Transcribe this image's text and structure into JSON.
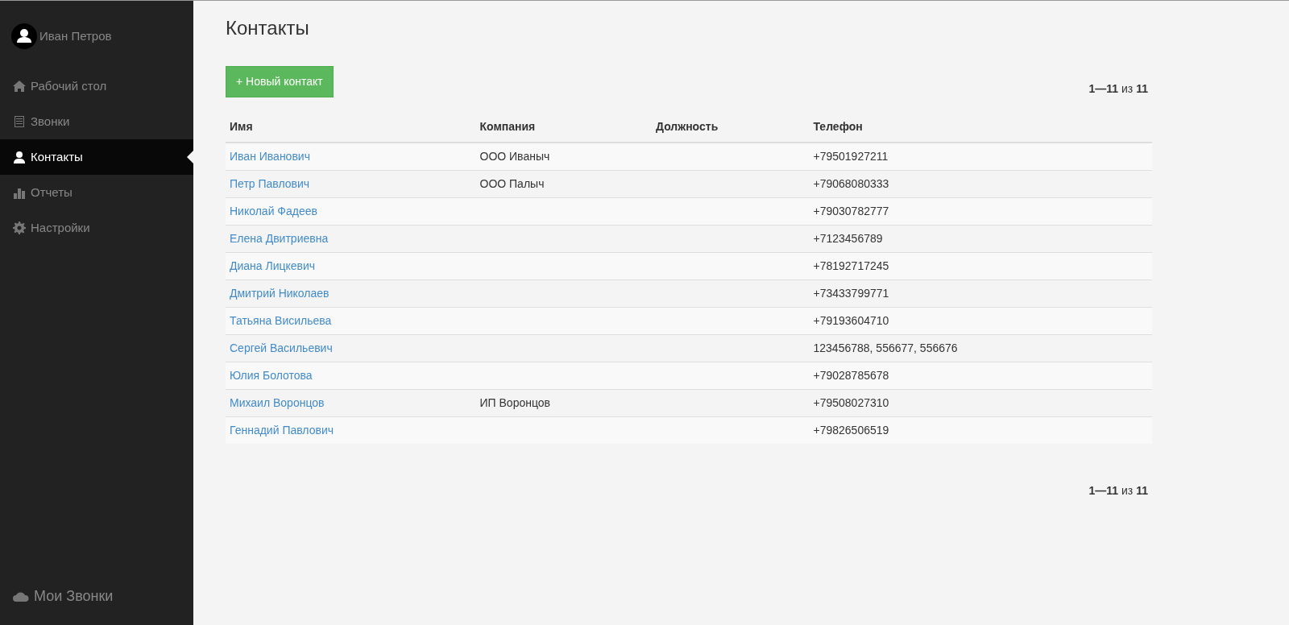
{
  "user": {
    "name": "Иван Петров"
  },
  "nav": [
    {
      "label": "Рабочий стол",
      "selected": false
    },
    {
      "label": "Звонки",
      "selected": false
    },
    {
      "label": "Контакты",
      "selected": true
    },
    {
      "label": "Отчеты",
      "selected": false
    },
    {
      "label": "Настройки",
      "selected": false
    }
  ],
  "brand": "Мои Звонки",
  "page_title": "Контакты",
  "new_button": "+ Новый контакт",
  "pagination_top": "**1—11** из **11**",
  "table": {
    "columns": [
      "Имя",
      "Компания",
      "Должность",
      "Телефон"
    ],
    "rows": [
      [
        "Иван Иванович",
        "ООО Иваныч",
        "",
        "+79501927211"
      ],
      [
        "Петр Павлович",
        "ООО Палыч",
        "",
        "+79068080333"
      ],
      [
        "Николай Фадеев",
        "",
        "",
        "+79030782777"
      ],
      [
        "Елена Двитриевна",
        "",
        "",
        "+7123456789"
      ],
      [
        "Диана Лицкевич",
        "",
        "",
        "+78192717245"
      ],
      [
        "Дмитрий Николаев",
        "",
        "",
        "+73433799771"
      ],
      [
        "Татьяна Висильева",
        "",
        "",
        "+79193604710"
      ],
      [
        "Сергей Васильевич",
        "",
        "",
        "123456788, 556677, 556676"
      ],
      [
        "Юлия Болотова",
        "",
        "",
        "+79028785678"
      ],
      [
        "Михаил Воронцов",
        "ИП Воронцов",
        "",
        "+79508027310"
      ],
      [
        "Геннадий Павлович",
        "",
        "",
        "+79826506519"
      ]
    ]
  },
  "pagination_bottom": "**1—11** из **11**"
}
